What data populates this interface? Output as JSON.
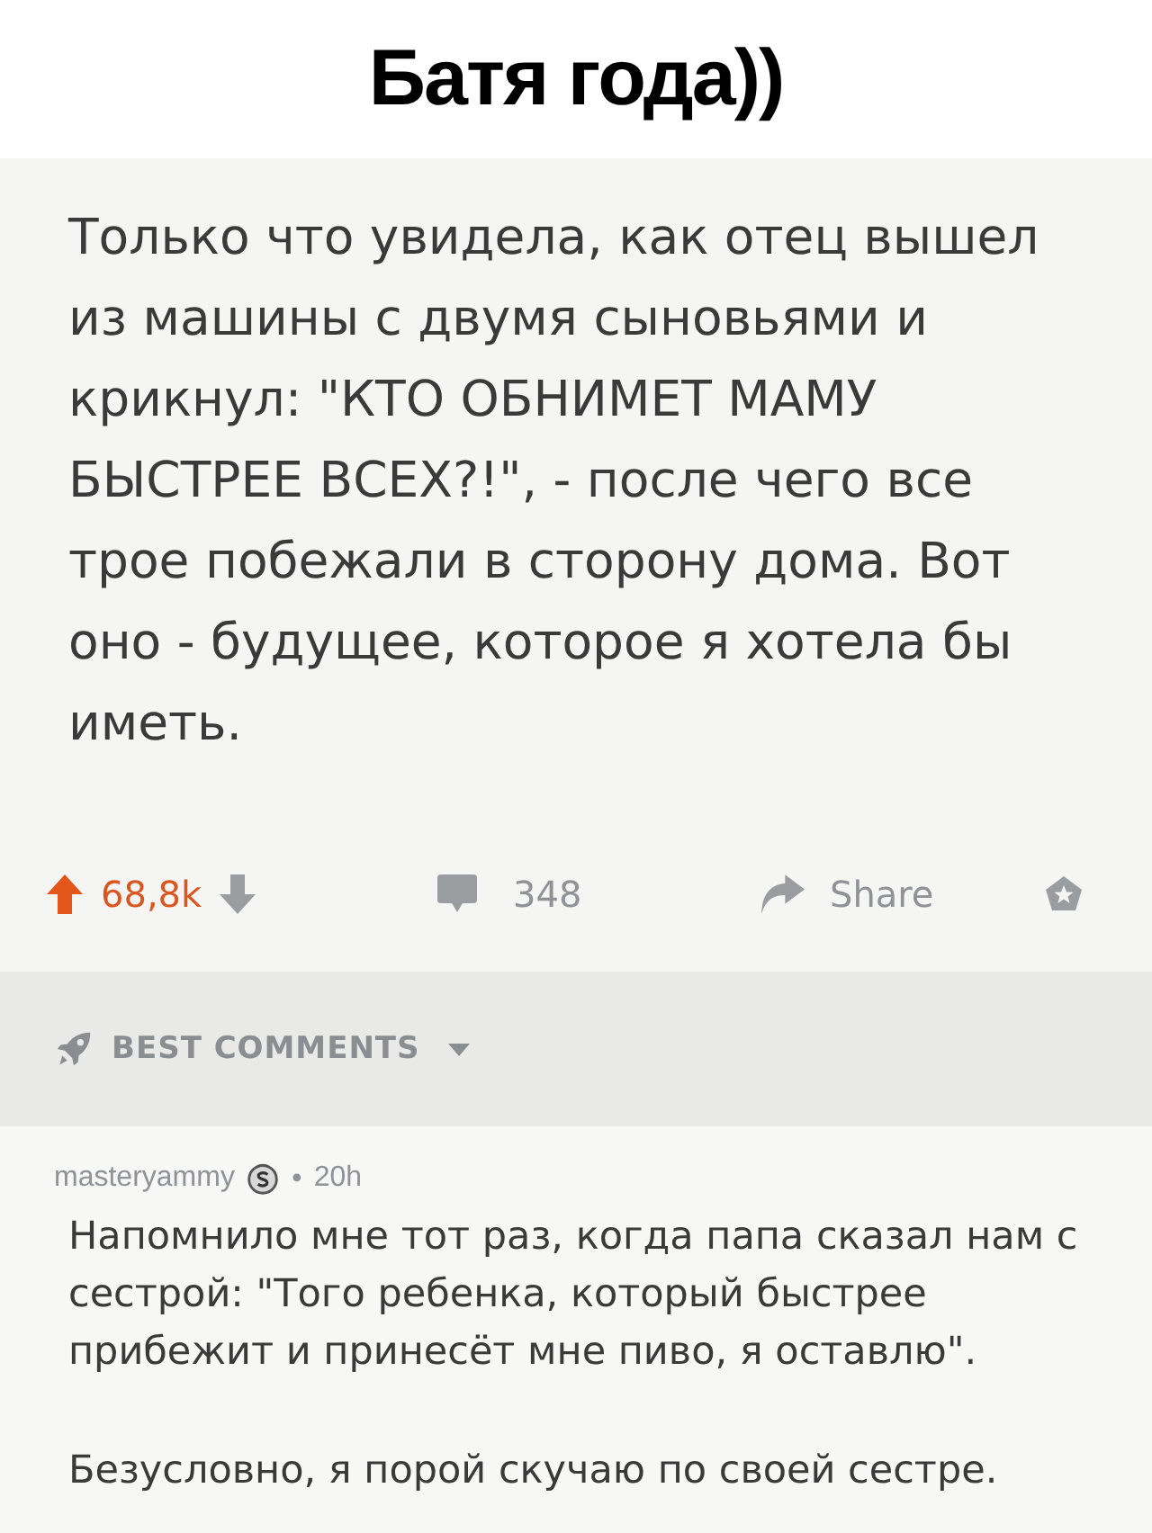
{
  "title": "Батя года))",
  "post": {
    "text": "Только что увидела, как отец вышел из машины с двумя сыновьями и крикнул: \"КТО ОБНИМЕТ МАМУ БЫСТРЕЕ ВСЕХ?!\", - после чего все трое побежали в сторону дома. Вот оно - будущее, которое я хотела бы иметь.",
    "votes": {
      "count": "68,8k",
      "upvoted": true
    },
    "comments_count": "348",
    "share_label": "Share"
  },
  "sort": {
    "label": "BEST COMMENTS"
  },
  "comment": {
    "author": "masteryammy",
    "separator": "•",
    "age": "20h",
    "paragraphs": [
      "Напомнило мне тот раз, когда папа сказал нам с сестрой: \"Того ребенка, который быстрее прибежит и принесёт мне пиво, я оставлю\".",
      "Безусловно, я порой скучаю по своей сестре."
    ]
  }
}
